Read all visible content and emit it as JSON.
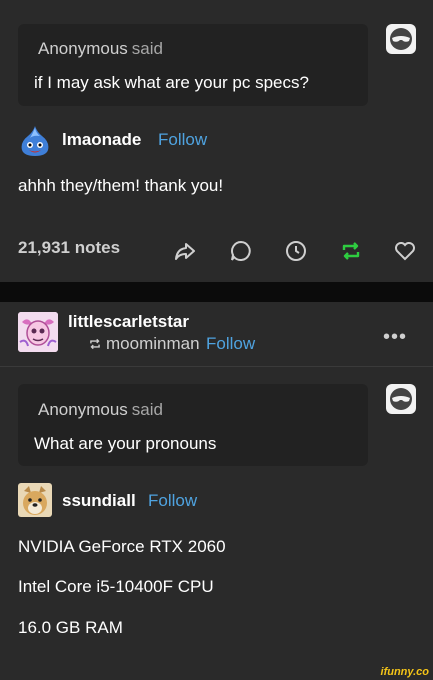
{
  "post1": {
    "ask": {
      "name": "Anonymous",
      "said": "said",
      "question": "if I may ask what are your pc specs?"
    },
    "answerer": {
      "username": "lmaonade",
      "follow": "Follow"
    },
    "body": "ahhh they/them! thank you!",
    "footer": {
      "notes": "21,931 notes"
    }
  },
  "post2": {
    "header": {
      "username": "littlescarletstar",
      "reblogged_from": "moominman",
      "follow": "Follow",
      "more": "•••"
    },
    "ask": {
      "name": "Anonymous",
      "said": "said",
      "question": "What are your pronouns"
    },
    "answerer": {
      "username": "ssundiall",
      "follow": "Follow"
    },
    "body": [
      "NVIDIA GeForce RTX 2060",
      "Intel Core i5-10400F CPU",
      "16.0 GB RAM"
    ]
  },
  "watermark": "ifunny.co",
  "colors": {
    "background": "#2a2a2a",
    "follow": "#4fa3e0",
    "reblog_active": "#2ecc40"
  },
  "icons": [
    "anonymous-mask-icon",
    "share-icon",
    "reply-icon",
    "clock-icon",
    "reblog-icon",
    "heart-icon",
    "reblog-small-icon",
    "more-icon"
  ]
}
